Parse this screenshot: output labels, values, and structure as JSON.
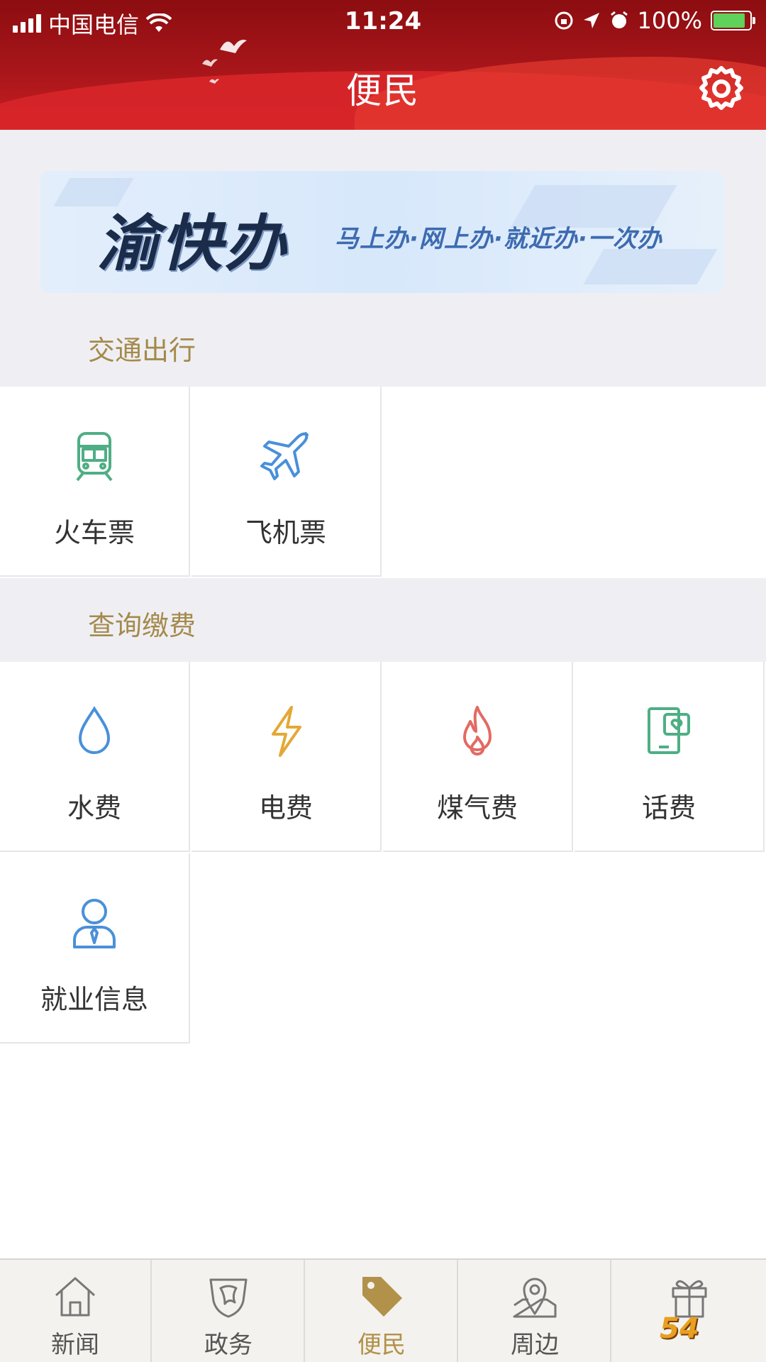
{
  "status_bar": {
    "carrier": "中国电信",
    "time": "11:24",
    "battery": "100%"
  },
  "header": {
    "title": "便民",
    "settings_icon": "gear-icon"
  },
  "banner": {
    "logo_text": "渝快办",
    "slogan": "马上办·网上办·就近办·一次办"
  },
  "sections": [
    {
      "title": "交通出行",
      "items": [
        {
          "label": "火车票",
          "icon": "train-icon",
          "color": "#4fae84"
        },
        {
          "label": "飞机票",
          "icon": "airplane-icon",
          "color": "#4a90d9"
        }
      ]
    },
    {
      "title": "查询缴费",
      "items": [
        {
          "label": "水费",
          "icon": "water-drop-icon",
          "color": "#4a90d9"
        },
        {
          "label": "电费",
          "icon": "lightning-icon",
          "color": "#e3a836"
        },
        {
          "label": "煤气费",
          "icon": "flame-icon",
          "color": "#e26a62"
        },
        {
          "label": "话费",
          "icon": "phone-bill-icon",
          "color": "#4fae84"
        },
        {
          "label": "就业信息",
          "icon": "person-tie-icon",
          "color": "#4a90d9"
        }
      ]
    }
  ],
  "bottom_nav": [
    {
      "label": "新闻",
      "icon": "home-icon"
    },
    {
      "label": "政务",
      "icon": "shield-icon"
    },
    {
      "label": "便民",
      "icon": "tag-icon",
      "active": true
    },
    {
      "label": "周边",
      "icon": "map-pin-icon"
    },
    {
      "label": "",
      "icon": "gift-icon"
    }
  ],
  "watermark": "54"
}
